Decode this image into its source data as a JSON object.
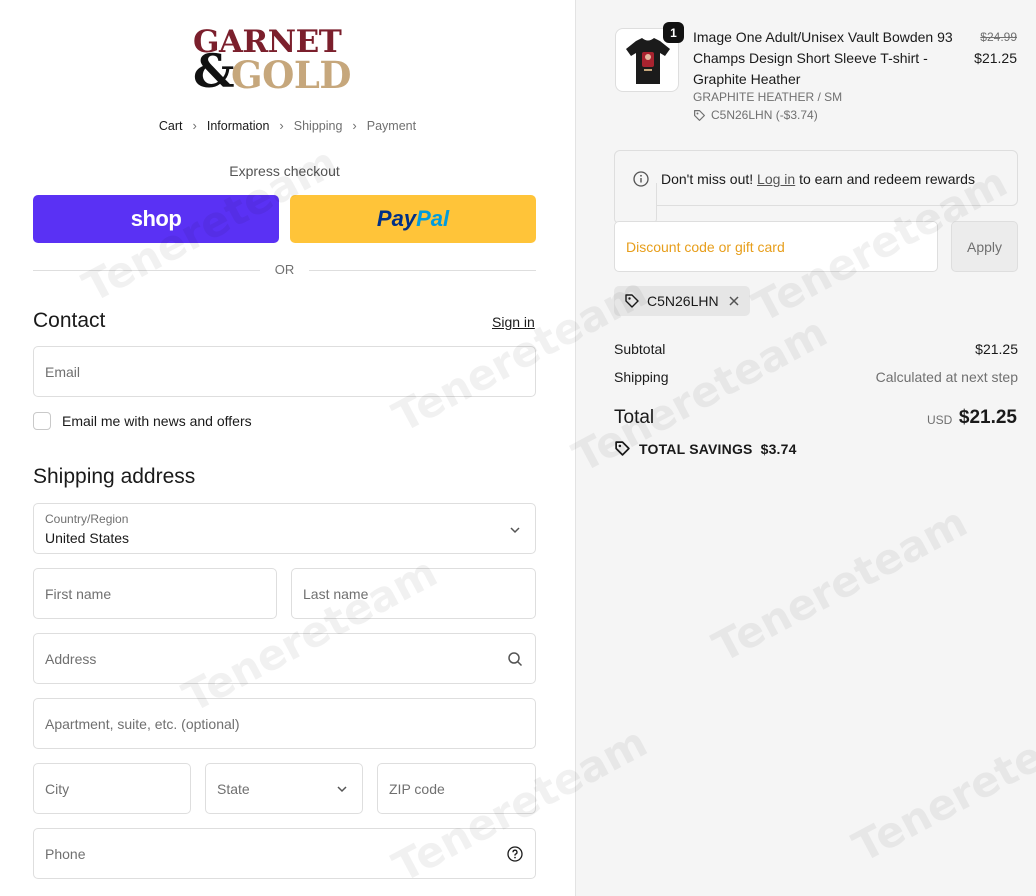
{
  "brand": {
    "line1": "GARNET",
    "ampersand": "&",
    "line2": "GOLD"
  },
  "breadcrumb": [
    {
      "label": "Cart",
      "state": "link"
    },
    {
      "label": "Information",
      "state": "current"
    },
    {
      "label": "Shipping",
      "state": "upcoming"
    },
    {
      "label": "Payment",
      "state": "upcoming"
    }
  ],
  "breadcrumb_separator": "›",
  "express": {
    "title": "Express checkout",
    "shop_label": "shop",
    "paypal_part1": "Pay",
    "paypal_part2": "Pal",
    "or_label": "OR"
  },
  "contact": {
    "heading": "Contact",
    "sign_in": "Sign in",
    "email_placeholder": "Email",
    "news_checkbox_label": "Email me with news and offers",
    "news_checked": false
  },
  "shipping": {
    "heading": "Shipping address",
    "country_label": "Country/Region",
    "country_value": "United States",
    "first_name_placeholder": "First name",
    "last_name_placeholder": "Last name",
    "address_placeholder": "Address",
    "apartment_placeholder": "Apartment, suite, etc. (optional)",
    "city_placeholder": "City",
    "state_placeholder": "State",
    "zip_placeholder": "ZIP code",
    "phone_placeholder": "Phone"
  },
  "order": {
    "quantity": "1",
    "product_name": "Image One Adult/Unisex Vault Bowden 93 Champs Design Short Sleeve T-shirt - Graphite Heather",
    "variant": "GRAPHITE HEATHER / SM",
    "discount_applied": "C5N26LHN (-$3.74)",
    "original_price": "$24.99",
    "price": "$21.25"
  },
  "rewards": {
    "before": "Don't miss out!",
    "link": "Log in",
    "after": "to earn and redeem rewards"
  },
  "discount": {
    "placeholder": "Discount code or gift card",
    "apply_label": "Apply",
    "code_chip": "C5N26LHN"
  },
  "summary": {
    "subtotal_label": "Subtotal",
    "subtotal_value": "$21.25",
    "shipping_label": "Shipping",
    "shipping_value": "Calculated at next step",
    "total_label": "Total",
    "currency": "USD",
    "total_value": "$21.25",
    "savings_label": "TOTAL SAVINGS",
    "savings_value": "$3.74"
  },
  "watermark_text": "Tenereteam",
  "colors": {
    "shop_purple": "#5a31f4",
    "paypal_yellow": "#ffc439",
    "brand_garnet": "#7b1f2c",
    "brand_gold": "#c6a77c",
    "discount_placeholder": "#e79e1b",
    "sidebar_bg": "#f5f5f5"
  }
}
